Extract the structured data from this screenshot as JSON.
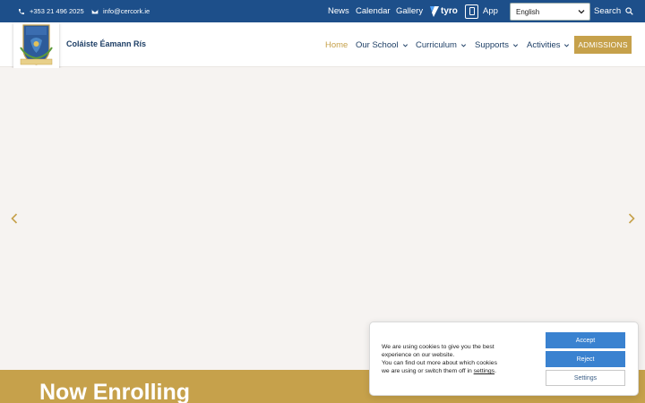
{
  "topbar": {
    "phone": "+353 21 496 2025",
    "email": "info@cercork.ie",
    "links": [
      "News",
      "Calendar",
      "Gallery"
    ],
    "tyro_label": "tyro",
    "app_label": "App",
    "language": "English",
    "search_label": "Search"
  },
  "header": {
    "school_name": "Coláiste Éamann Rís",
    "nav": [
      "Home",
      "Our School",
      "Curriculum",
      "Supports",
      "Activities"
    ],
    "admissions_label": "ADMISSIONS"
  },
  "hero": {
    "banner_title": "Now Enrolling"
  },
  "cookie": {
    "line1": "We are using cookies to give you the best",
    "line2": "experience on our website.",
    "line3": "You can find out more about which cookies",
    "line4_prefix": "we are using or switch them off in ",
    "line4_link": "settings",
    "line4_suffix": ".",
    "accept_label": "Accept",
    "reject_label": "Reject",
    "settings_label": "Settings"
  },
  "colors": {
    "topbar": "#1d4f8a",
    "gold": "#c6a14b",
    "navy": "#1e3f66",
    "hero_bg": "#f6f3f1",
    "button_blue": "#3a82d0"
  }
}
